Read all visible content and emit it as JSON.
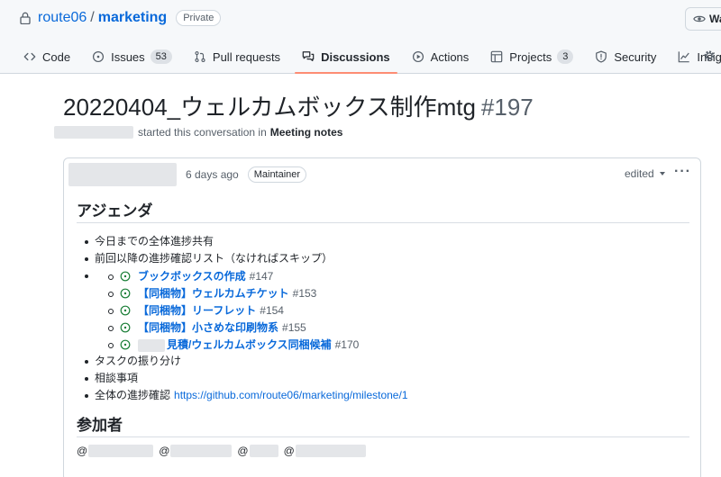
{
  "repo": {
    "owner": "route06",
    "separator": "/",
    "name": "marketing",
    "visibility": "Private"
  },
  "watch_label": "Watch",
  "tabs": [
    {
      "label": "Code",
      "icon": "code-icon"
    },
    {
      "label": "Issues",
      "count": "53",
      "icon": "issue-opened-icon"
    },
    {
      "label": "Pull requests",
      "icon": "git-pull-request-icon"
    },
    {
      "label": "Discussions",
      "icon": "comment-discussion-icon",
      "active": true
    },
    {
      "label": "Actions",
      "icon": "play-icon"
    },
    {
      "label": "Projects",
      "count": "3",
      "icon": "table-icon"
    },
    {
      "label": "Security",
      "icon": "shield-icon"
    },
    {
      "label": "Insights",
      "icon": "graph-icon"
    }
  ],
  "discussion": {
    "title": "20220404_ウェルカムボックス制作mtg",
    "number": "#197",
    "byline_text": "started this conversation in",
    "category": "Meeting notes"
  },
  "comment": {
    "time": "6 days ago",
    "role_badge": "Maintainer",
    "edited_label": "edited",
    "menu_label": "···",
    "heading_agenda": "アジェンダ",
    "agenda": [
      {
        "text": "今日までの全体進捗共有"
      },
      {
        "text": "前回以降の進捗確認リスト（なければスキップ）"
      },
      {
        "text": "タスクの振り分け"
      },
      {
        "text": "相談事項"
      },
      {
        "text": "全体の進捗確認",
        "link": "https://github.com/route06/marketing/milestone/1"
      }
    ],
    "linked_issues": [
      {
        "title": "ブックボックスの作成",
        "number": "#147"
      },
      {
        "title": "【同梱物】ウェルカムチケット",
        "number": "#153"
      },
      {
        "title": "【同梱物】リーフレット",
        "number": "#154"
      },
      {
        "title": "【同梱物】小さめな印刷物系",
        "number": "#155"
      },
      {
        "title": "見積/ウェルカムボックス同梱候補",
        "number": "#170"
      }
    ],
    "heading_participants": "参加者",
    "participant_prefix": "@"
  },
  "colors": {
    "link": "#0969da",
    "active_tab_underline": "#fd8c73",
    "open_issue": "#1a7f37",
    "muted": "#57606a"
  }
}
